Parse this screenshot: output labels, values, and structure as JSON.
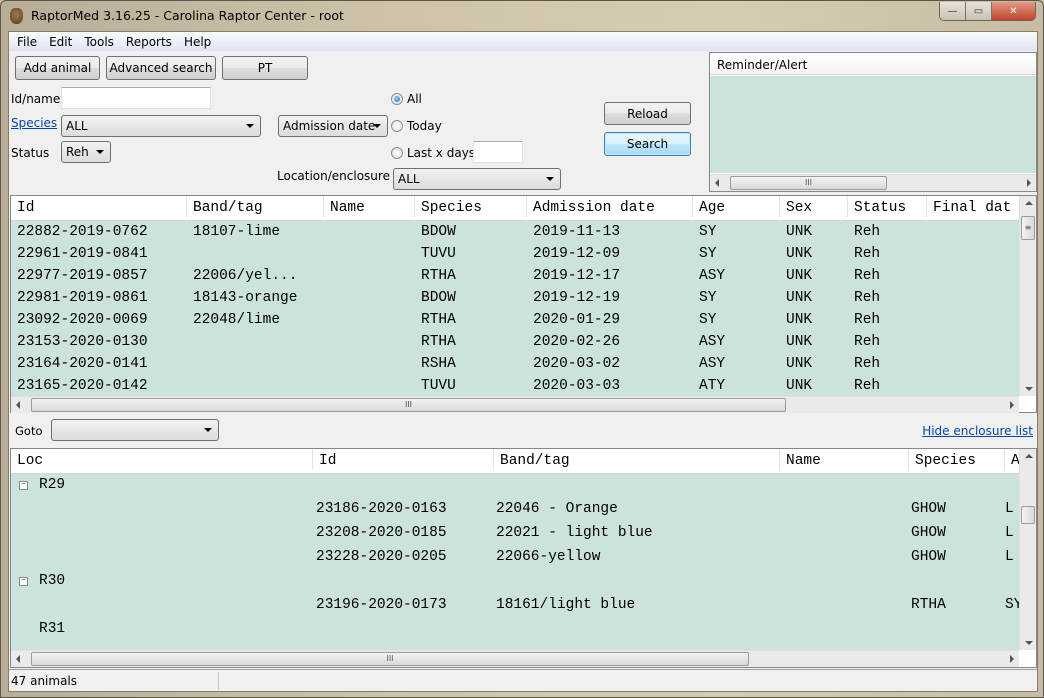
{
  "window": {
    "title": "RaptorMed 3.16.25 - Carolina Raptor Center - root",
    "controls": {
      "minimize": "—",
      "maximize": "▭",
      "close": "✕"
    }
  },
  "menu": [
    "File",
    "Edit",
    "Tools",
    "Reports",
    "Help"
  ],
  "toolbar": {
    "add_animal": "Add animal",
    "advanced_search": "Advanced search",
    "pt": "PT"
  },
  "filters": {
    "id_name_label": "Id/name",
    "id_name_value": "",
    "species_label": "Species",
    "species_value": "ALL",
    "status_label": "Status",
    "status_value": "Reh",
    "date_field_value": "Admission date",
    "radio_all": "All",
    "radio_today": "Today",
    "radio_last_x_days": "Last x days",
    "last_x_days_value": "",
    "selected_radio": "All",
    "location_label": "Location/enclosure",
    "location_value": "ALL",
    "reload": "Reload",
    "search": "Search"
  },
  "alerts": {
    "header": "Reminder/Alert"
  },
  "animals_table": {
    "columns": [
      "Id",
      "Band/tag",
      "Name",
      "Species",
      "Admission date",
      "Age",
      "Sex",
      "Status",
      "Final dat"
    ],
    "rows": [
      [
        "22882-2019-0762",
        "18107-lime",
        "",
        "BDOW",
        "2019-11-13",
        "SY",
        "UNK",
        "Reh",
        ""
      ],
      [
        "22961-2019-0841",
        "",
        "",
        "TUVU",
        "2019-12-09",
        "SY",
        "UNK",
        "Reh",
        ""
      ],
      [
        "22977-2019-0857",
        "22006/yel...",
        "",
        "RTHA",
        "2019-12-17",
        "ASY",
        "UNK",
        "Reh",
        ""
      ],
      [
        "22981-2019-0861",
        "18143-orange",
        "",
        "BDOW",
        "2019-12-19",
        "SY",
        "UNK",
        "Reh",
        ""
      ],
      [
        "23092-2020-0069",
        "22048/lime",
        "",
        "RTHA",
        "2020-01-29",
        "SY",
        "UNK",
        "Reh",
        ""
      ],
      [
        "23153-2020-0130",
        "",
        "",
        "RTHA",
        "2020-02-26",
        "ASY",
        "UNK",
        "Reh",
        ""
      ],
      [
        "23164-2020-0141",
        "",
        "",
        "RSHA",
        "2020-03-02",
        "ASY",
        "UNK",
        "Reh",
        ""
      ],
      [
        "23165-2020-0142",
        "",
        "",
        "TUVU",
        "2020-03-03",
        "ATY",
        "UNK",
        "Reh",
        ""
      ]
    ]
  },
  "goto": {
    "label": "Goto",
    "value": ""
  },
  "hide_enclosure_link": "Hide enclosure list",
  "enclosure_table": {
    "columns": [
      "Loc",
      "Id",
      "Band/tag",
      "Name",
      "Species",
      "A"
    ],
    "groups": [
      {
        "loc": "R29",
        "expanded": true,
        "toggle": "−",
        "rows": [
          [
            "23186-2020-0163",
            "22046 - Orange",
            "",
            "GHOW",
            "L"
          ],
          [
            "23208-2020-0185",
            "22021 - light blue",
            "",
            "GHOW",
            "L"
          ],
          [
            "23228-2020-0205",
            "22066-yellow",
            "",
            "GHOW",
            "L"
          ]
        ]
      },
      {
        "loc": "R30",
        "expanded": true,
        "toggle": "−",
        "rows": [
          [
            "23196-2020-0173",
            "18161/light blue",
            "",
            "RTHA",
            "SY"
          ]
        ]
      },
      {
        "loc": "R31",
        "expanded": false,
        "toggle": "",
        "rows": []
      }
    ]
  },
  "scroll": {
    "grip": "III",
    "vgrip": "≡"
  },
  "status": {
    "count": "47 animals"
  }
}
